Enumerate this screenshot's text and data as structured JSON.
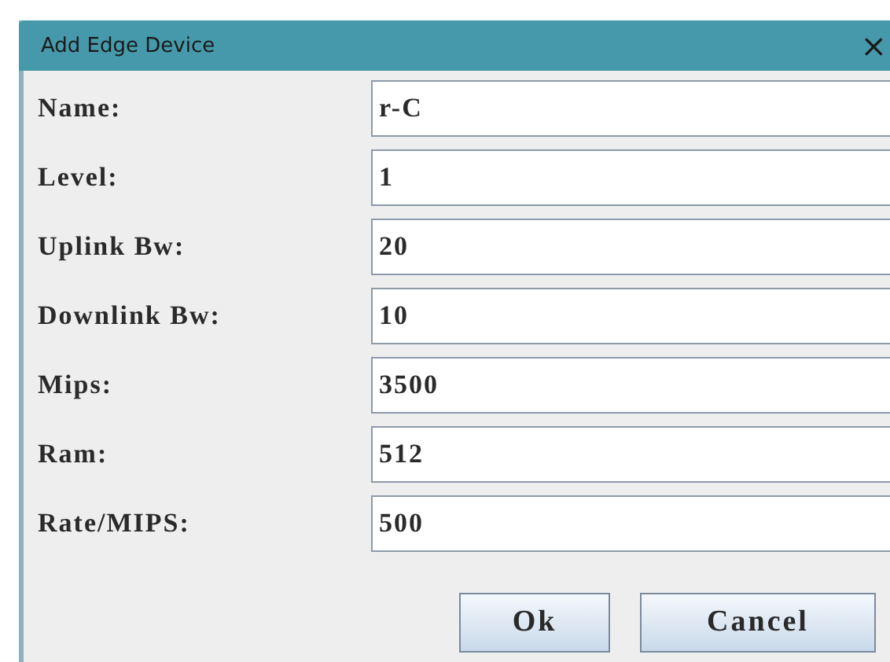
{
  "window": {
    "title": "Add Edge Device",
    "close": "×"
  },
  "fields": [
    {
      "label": "Name:",
      "value": "r-C"
    },
    {
      "label": "Level:",
      "value": "1"
    },
    {
      "label": "Uplink Bw:",
      "value": "20"
    },
    {
      "label": "Downlink Bw:",
      "value": "10"
    },
    {
      "label": "Mips:",
      "value": "3500"
    },
    {
      "label": "Ram:",
      "value": "512"
    },
    {
      "label": "Rate/MIPS:",
      "value": "500"
    }
  ],
  "buttons": [
    "Ok",
    "Cancel"
  ]
}
